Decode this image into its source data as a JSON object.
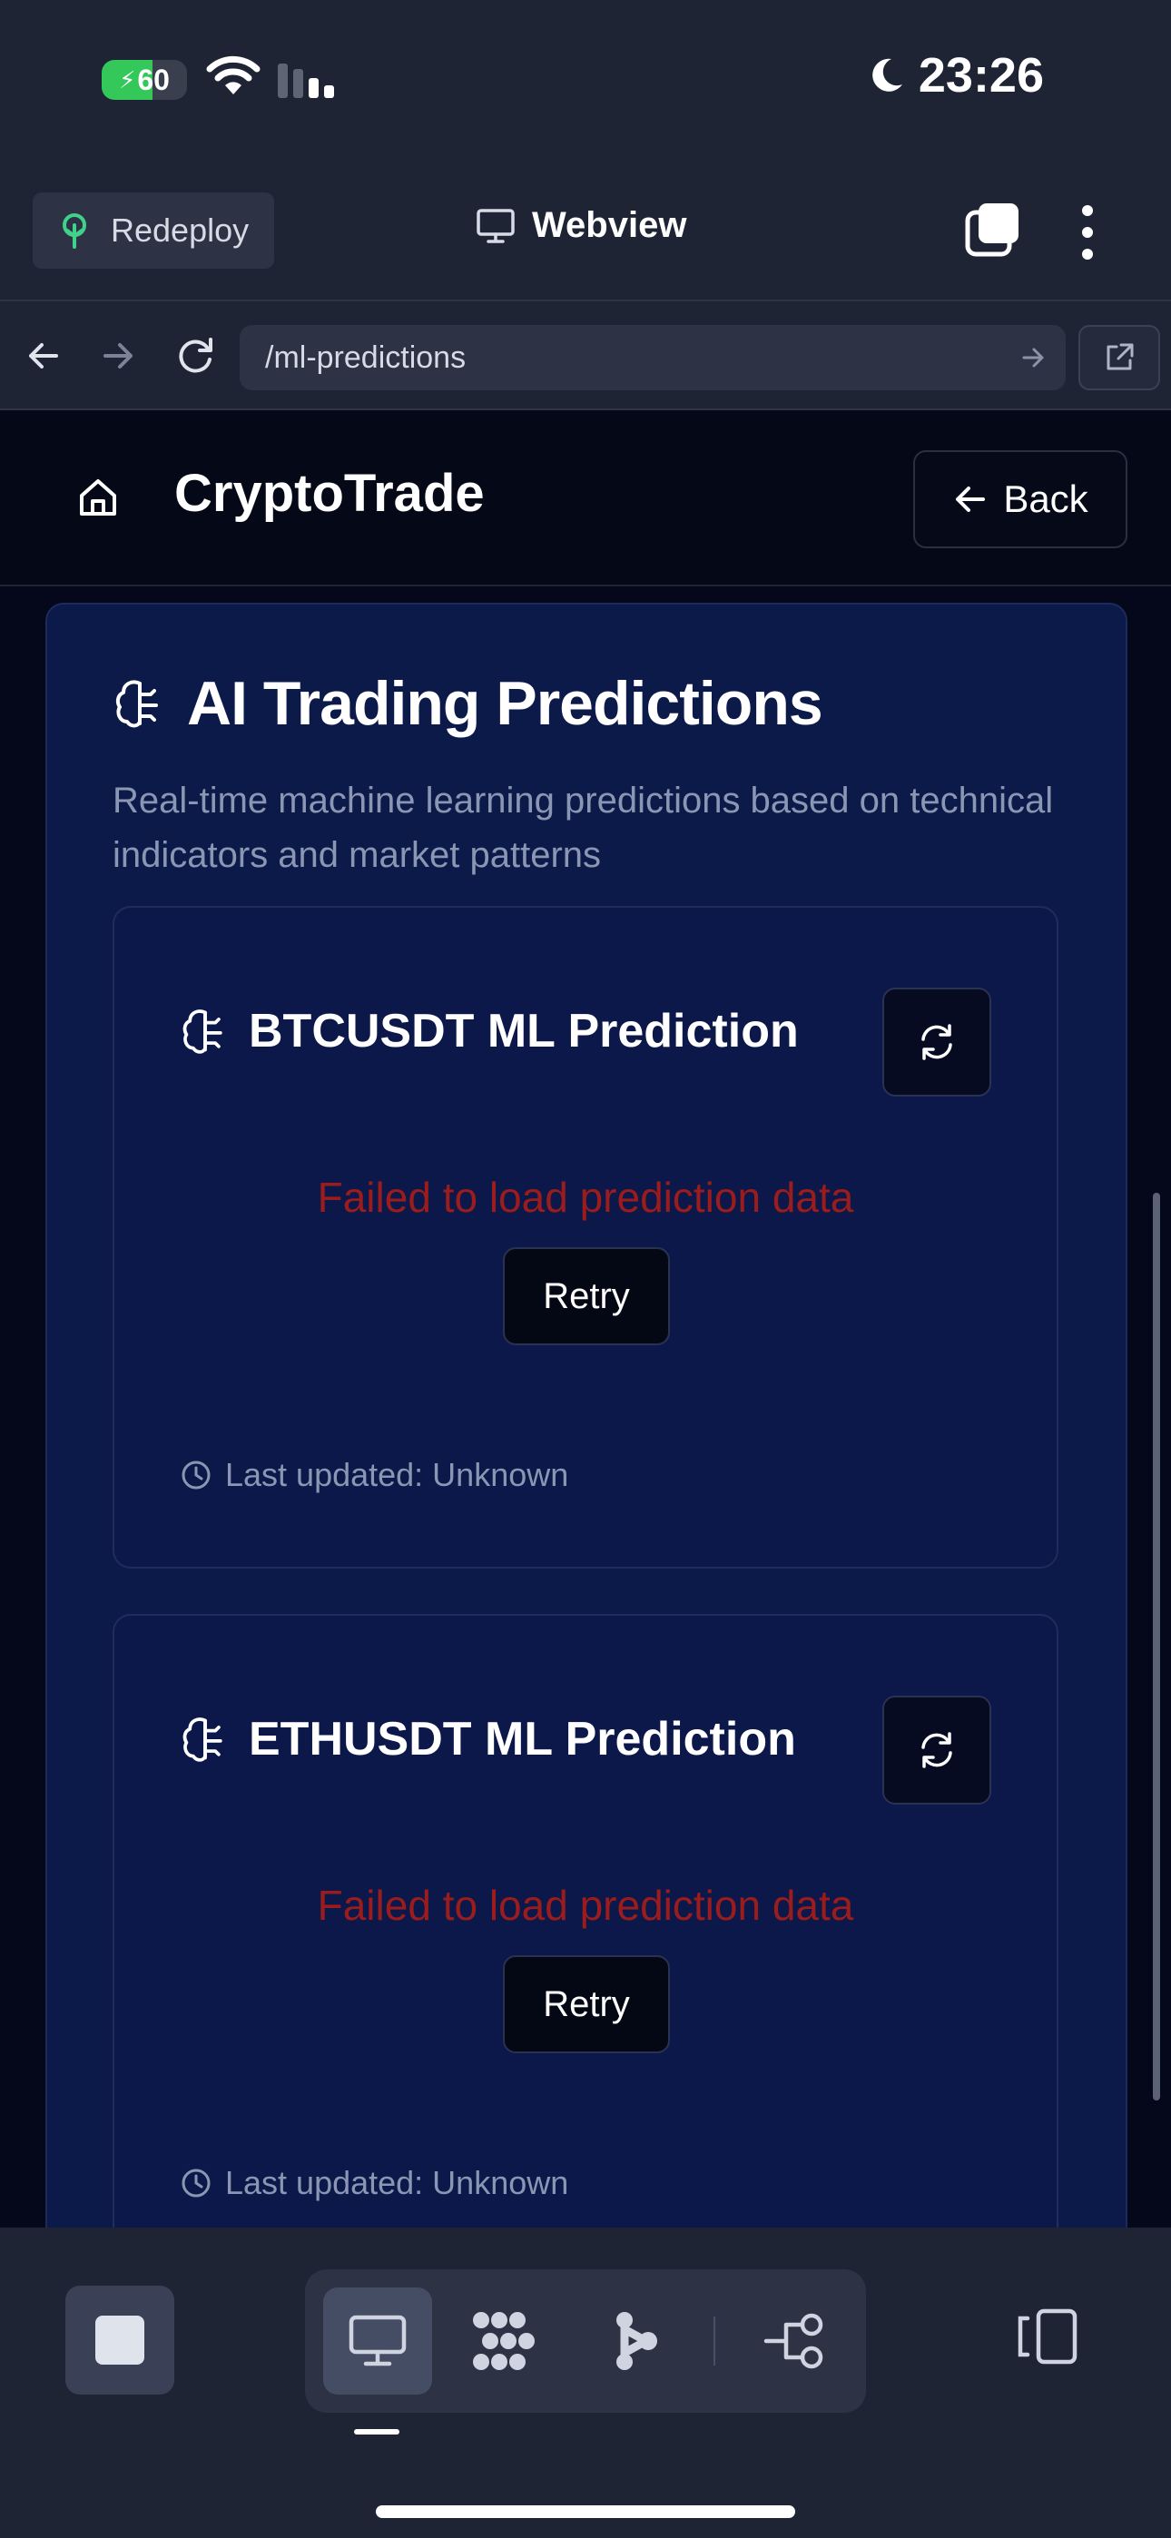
{
  "status": {
    "battery": "60",
    "battery_level": 0.6,
    "time": "23:26"
  },
  "topbar": {
    "redeploy_label": "Redeploy",
    "title": "Webview"
  },
  "urlbar": {
    "url": "/ml-predictions"
  },
  "app": {
    "brand": "CryptoTrade",
    "back_label": "Back"
  },
  "panel": {
    "title": "AI Trading Predictions",
    "subtitle": "Real-time machine learning predictions based on technical indicators and market patterns"
  },
  "cards": [
    {
      "title": "BTCUSDT ML Prediction",
      "error": "Failed to load prediction data",
      "retry_label": "Retry",
      "updated": "Last updated: Unknown"
    },
    {
      "title": "ETHUSDT ML Prediction",
      "error": "Failed to load prediction data",
      "retry_label": "Retry",
      "updated": "Last updated: Unknown"
    }
  ],
  "toolbar": {
    "icons": [
      "stop-icon",
      "webview-icon",
      "workspace-icon",
      "agent-icon",
      "git-icon",
      "layout-icon"
    ]
  },
  "colors": {
    "error": "#9b1c1c",
    "panel_bg": "#0c1a4a",
    "app_bg": "#04081a",
    "chrome_bg": "#1f2435"
  }
}
